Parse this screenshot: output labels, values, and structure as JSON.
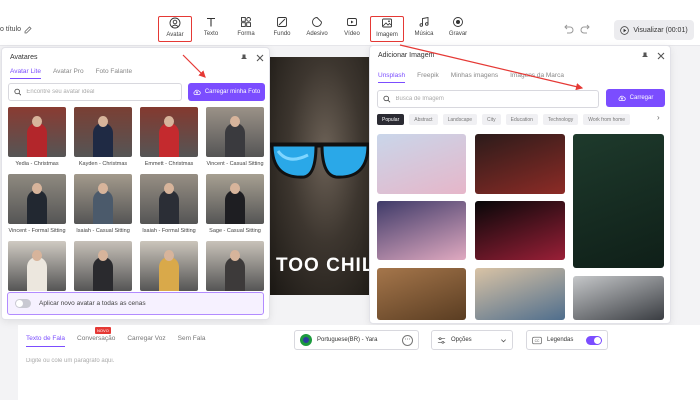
{
  "header": {
    "doc_title": "o título",
    "tools": [
      {
        "label": "Avatar",
        "icon": "avatar-icon",
        "highlighted": true
      },
      {
        "label": "Texto",
        "icon": "text-icon",
        "highlighted": false
      },
      {
        "label": "Forma",
        "icon": "shape-icon",
        "highlighted": false
      },
      {
        "label": "Fundo",
        "icon": "background-icon",
        "highlighted": false
      },
      {
        "label": "Adesivo",
        "icon": "sticker-icon",
        "highlighted": false
      },
      {
        "label": "Vídeo",
        "icon": "video-icon",
        "highlighted": false
      },
      {
        "label": "Imagem",
        "icon": "image-icon",
        "highlighted": true
      },
      {
        "label": "Música",
        "icon": "music-icon",
        "highlighted": false
      },
      {
        "label": "Gravar",
        "icon": "record-icon",
        "highlighted": false
      }
    ],
    "preview_button": "Visualizar (00:01)"
  },
  "canvas": {
    "caption": "TOO CHIL"
  },
  "avatars_panel": {
    "title": "Avatares",
    "tabs": [
      "Avatar Lite",
      "Avatar Pro",
      "Foto Falante"
    ],
    "active_tab": "Avatar Lite",
    "search_placeholder": "Encontre seu avatar ideal",
    "upload_button": "Carregar minha Foto",
    "avatars": [
      {
        "name": "Yedia - Christmas",
        "bg": "#8a3b32",
        "outfit": "#b3262b"
      },
      {
        "name": "Kayden - Christmas",
        "bg": "#7a3f34",
        "outfit": "#1f2a44"
      },
      {
        "name": "Emmett - Christmas",
        "bg": "#84392f",
        "outfit": "#c42a2e"
      },
      {
        "name": "Vincent - Casual Sitting",
        "bg": "#9b9288",
        "outfit": "#3a3a3e"
      },
      {
        "name": "Vincent - Formal Sitting",
        "bg": "#8f8a80",
        "outfit": "#222831"
      },
      {
        "name": "Isaiah - Casual Sitting",
        "bg": "#a39a8c",
        "outfit": "#4b5a6b"
      },
      {
        "name": "Isaiah - Formal Sitting",
        "bg": "#978f84",
        "outfit": "#2b2e36"
      },
      {
        "name": "Sage - Casual Sitting",
        "bg": "#a7a092",
        "outfit": "#1e1e22"
      },
      {
        "name": "",
        "bg": "#cfcac2",
        "outfit": "#ece7de"
      },
      {
        "name": "",
        "bg": "#c6c0b8",
        "outfit": "#2a2a2e"
      },
      {
        "name": "",
        "bg": "#cbc5bb",
        "outfit": "#d9a94a"
      },
      {
        "name": "",
        "bg": "#c8c2b9",
        "outfit": "#3d3a3a"
      }
    ],
    "apply_all_label": "Aplicar novo avatar a todas as cenas"
  },
  "image_panel": {
    "title": "Adicionar Imagem",
    "tabs": [
      "Unsplash",
      "Freepik",
      "Minhas imagens",
      "Imagens da Marca"
    ],
    "active_tab": "Unsplash",
    "search_placeholder": "Busca de Imagem",
    "upload_button": "Carregar",
    "chips": [
      "Popular",
      "Abstract",
      "Landscape",
      "City",
      "Education",
      "Technology",
      "Work from home"
    ],
    "active_chip": "Popular",
    "images": [
      {
        "name": "image-cherry-blossom",
        "colors": [
          "#c9d6ea",
          "#e6b6c9"
        ]
      },
      {
        "name": "image-car-interior",
        "colors": [
          "#2b1b1a",
          "#8d2b26"
        ]
      },
      {
        "name": "image-green-car",
        "colors": [
          "#1e3a2c",
          "#0f1f18"
        ]
      },
      {
        "name": "image-purple-sky",
        "colors": [
          "#3e3a68",
          "#e0a9c0"
        ]
      },
      {
        "name": "image-dark-flower",
        "colors": [
          "#070708",
          "#9a1f37"
        ]
      },
      {
        "name": "image-food-bowl",
        "colors": [
          "#a5764b",
          "#5a3d22"
        ]
      },
      {
        "name": "image-picture-wall",
        "colors": [
          "#d9c3a5",
          "#4f6e8d"
        ]
      },
      {
        "name": "image-silver-car",
        "colors": [
          "#c5c7c9",
          "#3a3d42"
        ]
      }
    ]
  },
  "bottom": {
    "tabs": [
      "Texto de Fala",
      "Conversação",
      "Carregar Voz",
      "Sem Fala"
    ],
    "active_tab": "Texto de Fala",
    "new_badge": "NOVO",
    "voice_label": "Portuguese(BR) - Yara",
    "more_label": "⋯",
    "options_label": "Opções",
    "captions_label": "Legendas",
    "paragraph_placeholder": "Digite ou cole um parágrafo aqui."
  },
  "colors": {
    "accent": "#7b4dff",
    "highlight": "#e53935"
  }
}
